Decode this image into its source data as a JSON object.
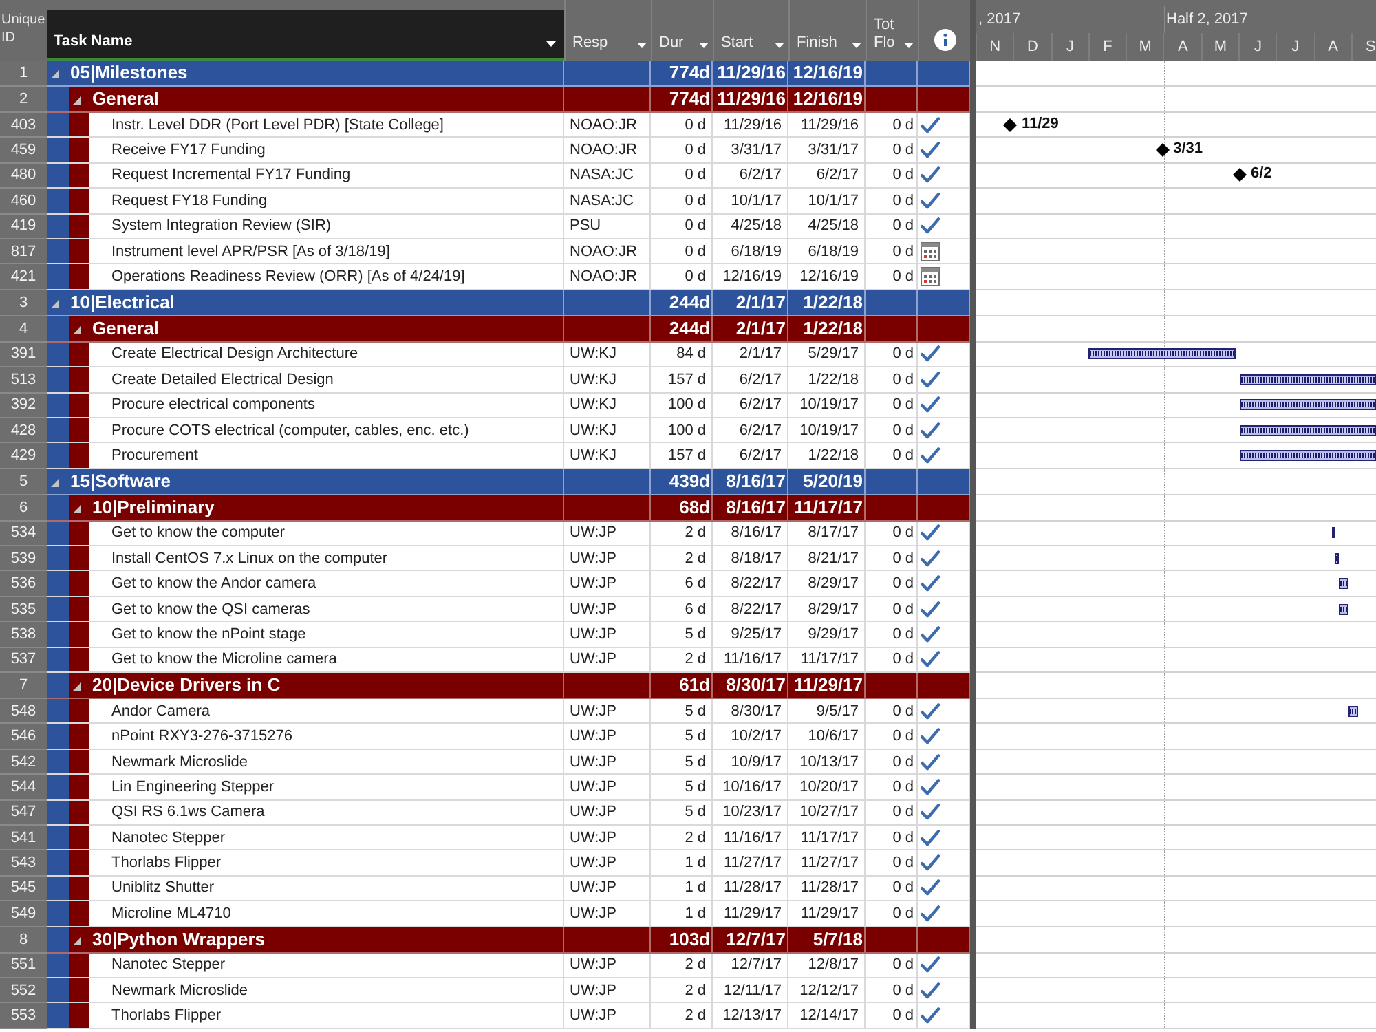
{
  "header": {
    "id_label": "Unique ID",
    "columns": [
      "Task Name",
      "Resp",
      "Dur",
      "Start",
      "Finish",
      "Tot Flo"
    ]
  },
  "timescale": {
    "periods": [
      ", 2017",
      "Half 2, 2017"
    ],
    "months": [
      "N",
      "D",
      "J",
      "F",
      "M",
      "A",
      "M",
      "J",
      "J",
      "A",
      "S"
    ]
  },
  "rows": [
    {
      "id": "1",
      "kind": "summary",
      "name": "05|Milestones",
      "expanded": true,
      "dur": "774d",
      "start": "11/29/16",
      "finish": "12/16/19",
      "children": [
        {
          "id": "2",
          "kind": "summary",
          "name": "General",
          "expanded": true,
          "dur": "774d",
          "start": "11/29/16",
          "finish": "12/16/19",
          "children": [
            {
              "id": "403",
              "kind": "milestone",
              "name": "Instr. Level DDR (Port Level PDR) [State College]",
              "resp": "NOAO:JR",
              "dur": "0 d",
              "start": "11/29/16",
              "finish": "11/29/16",
              "float": "0 d",
              "complete": true,
              "constrained": false,
              "bar_label": "11/29"
            },
            {
              "id": "459",
              "kind": "milestone",
              "name": "Receive FY17 Funding",
              "resp": "NOAO:JR",
              "dur": "0 d",
              "start": "3/31/17",
              "finish": "3/31/17",
              "float": "0 d",
              "complete": true,
              "constrained": false,
              "bar_label": "3/31"
            },
            {
              "id": "480",
              "kind": "milestone",
              "name": "Request Incremental FY17 Funding",
              "resp": "NASA:JC",
              "dur": "0 d",
              "start": "6/2/17",
              "finish": "6/2/17",
              "float": "0 d",
              "complete": true,
              "constrained": false,
              "bar_label": "6/2"
            },
            {
              "id": "460",
              "kind": "milestone",
              "name": "Request FY18 Funding",
              "resp": "NASA:JC",
              "dur": "0 d",
              "start": "10/1/17",
              "finish": "10/1/17",
              "float": "0 d",
              "complete": true,
              "constrained": false
            },
            {
              "id": "419",
              "kind": "milestone",
              "name": "System Integration Review (SIR)",
              "resp": "PSU",
              "dur": "0 d",
              "start": "4/25/18",
              "finish": "4/25/18",
              "float": "0 d",
              "complete": true,
              "constrained": false
            },
            {
              "id": "817",
              "kind": "milestone",
              "name": "Instrument level APR/PSR [As of 3/18/19]",
              "resp": "NOAO:JR",
              "dur": "0 d",
              "start": "6/18/19",
              "finish": "6/18/19",
              "float": "0 d",
              "complete": false,
              "constrained": true
            },
            {
              "id": "421",
              "kind": "milestone",
              "name": "Operations Readiness Review (ORR) [As of 4/24/19]",
              "resp": "NOAO:JR",
              "dur": "0 d",
              "start": "12/16/19",
              "finish": "12/16/19",
              "float": "0 d",
              "complete": false,
              "constrained": true
            }
          ]
        }
      ]
    },
    {
      "id": "3",
      "kind": "summary",
      "name": "10|Electrical",
      "expanded": true,
      "dur": "244d",
      "start": "2/1/17",
      "finish": "1/22/18",
      "children": [
        {
          "id": "4",
          "kind": "summary",
          "name": "General",
          "expanded": true,
          "dur": "244d",
          "start": "2/1/17",
          "finish": "1/22/18",
          "children": [
            {
              "id": "391",
              "kind": "task",
              "name": "Create Electrical Design Architecture",
              "resp": "UW:KJ",
              "dur": "84 d",
              "start": "2/1/17",
              "finish": "5/29/17",
              "float": "0 d",
              "complete": true,
              "constrained": false
            },
            {
              "id": "513",
              "kind": "task",
              "name": "Create Detailed Electrical Design",
              "resp": "UW:KJ",
              "dur": "157 d",
              "start": "6/2/17",
              "finish": "1/22/18",
              "float": "0 d",
              "complete": true,
              "constrained": false
            },
            {
              "id": "392",
              "kind": "task",
              "name": "Procure electrical components",
              "resp": "UW:KJ",
              "dur": "100 d",
              "start": "6/2/17",
              "finish": "10/19/17",
              "float": "0 d",
              "complete": true,
              "constrained": false
            },
            {
              "id": "428",
              "kind": "task",
              "name": "Procure COTS electrical (computer, cables, enc. etc.)",
              "resp": "UW:KJ",
              "dur": "100 d",
              "start": "6/2/17",
              "finish": "10/19/17",
              "float": "0 d",
              "complete": true,
              "constrained": false
            },
            {
              "id": "429",
              "kind": "task",
              "name": "Procurement",
              "resp": "UW:KJ",
              "dur": "157 d",
              "start": "6/2/17",
              "finish": "1/22/18",
              "float": "0 d",
              "complete": true,
              "constrained": false
            }
          ]
        }
      ]
    },
    {
      "id": "5",
      "kind": "summary",
      "name": "15|Software",
      "expanded": true,
      "dur": "439d",
      "start": "8/16/17",
      "finish": "5/20/19",
      "children": [
        {
          "id": "6",
          "kind": "summary",
          "name": "10|Preliminary",
          "expanded": true,
          "dur": "68d",
          "start": "8/16/17",
          "finish": "11/17/17",
          "children": [
            {
              "id": "534",
              "kind": "task",
              "name": "Get to know the computer",
              "resp": "UW:JP",
              "dur": "2 d",
              "start": "8/16/17",
              "finish": "8/17/17",
              "float": "0 d",
              "complete": true,
              "constrained": false
            },
            {
              "id": "539",
              "kind": "task",
              "name": "Install CentOS 7.x Linux on the computer",
              "resp": "UW:JP",
              "dur": "2 d",
              "start": "8/18/17",
              "finish": "8/21/17",
              "float": "0 d",
              "complete": true,
              "constrained": false
            },
            {
              "id": "536",
              "kind": "task",
              "name": "Get to know the Andor camera",
              "resp": "UW:JP",
              "dur": "6 d",
              "start": "8/22/17",
              "finish": "8/29/17",
              "float": "0 d",
              "complete": true,
              "constrained": false
            },
            {
              "id": "535",
              "kind": "task",
              "name": "Get to know the QSI cameras",
              "resp": "UW:JP",
              "dur": "6 d",
              "start": "8/22/17",
              "finish": "8/29/17",
              "float": "0 d",
              "complete": true,
              "constrained": false
            },
            {
              "id": "538",
              "kind": "task",
              "name": "Get to know the nPoint stage",
              "resp": "UW:JP",
              "dur": "5 d",
              "start": "9/25/17",
              "finish": "9/29/17",
              "float": "0 d",
              "complete": true,
              "constrained": false
            },
            {
              "id": "537",
              "kind": "task",
              "name": "Get to know the Microline camera",
              "resp": "UW:JP",
              "dur": "2 d",
              "start": "11/16/17",
              "finish": "11/17/17",
              "float": "0 d",
              "complete": true,
              "constrained": false
            }
          ]
        },
        {
          "id": "7",
          "kind": "summary",
          "name": "20|Device Drivers in C",
          "expanded": true,
          "dur": "61d",
          "start": "8/30/17",
          "finish": "11/29/17",
          "children": [
            {
              "id": "548",
              "kind": "task",
              "name": "Andor Camera",
              "resp": "UW:JP",
              "dur": "5 d",
              "start": "8/30/17",
              "finish": "9/5/17",
              "float": "0 d",
              "complete": true,
              "constrained": false
            },
            {
              "id": "546",
              "kind": "task",
              "name": "nPoint RXY3-276-3715276",
              "resp": "UW:JP",
              "dur": "5 d",
              "start": "10/2/17",
              "finish": "10/6/17",
              "float": "0 d",
              "complete": true,
              "constrained": false
            },
            {
              "id": "542",
              "kind": "task",
              "name": "Newmark Microslide",
              "resp": "UW:JP",
              "dur": "5 d",
              "start": "10/9/17",
              "finish": "10/13/17",
              "float": "0 d",
              "complete": true,
              "constrained": false
            },
            {
              "id": "544",
              "kind": "task",
              "name": "Lin Engineering Stepper",
              "resp": "UW:JP",
              "dur": "5 d",
              "start": "10/16/17",
              "finish": "10/20/17",
              "float": "0 d",
              "complete": true,
              "constrained": false
            },
            {
              "id": "547",
              "kind": "task",
              "name": "QSI RS 6.1ws Camera",
              "resp": "UW:JP",
              "dur": "5 d",
              "start": "10/23/17",
              "finish": "10/27/17",
              "float": "0 d",
              "complete": true,
              "constrained": false
            },
            {
              "id": "541",
              "kind": "task",
              "name": "Nanotec Stepper",
              "resp": "UW:JP",
              "dur": "2 d",
              "start": "11/16/17",
              "finish": "11/17/17",
              "float": "0 d",
              "complete": true,
              "constrained": false
            },
            {
              "id": "543",
              "kind": "task",
              "name": "Thorlabs Flipper",
              "resp": "UW:JP",
              "dur": "1 d",
              "start": "11/27/17",
              "finish": "11/27/17",
              "float": "0 d",
              "complete": true,
              "constrained": false
            },
            {
              "id": "545",
              "kind": "task",
              "name": "Uniblitz Shutter",
              "resp": "UW:JP",
              "dur": "1 d",
              "start": "11/28/17",
              "finish": "11/28/17",
              "float": "0 d",
              "complete": true,
              "constrained": false
            },
            {
              "id": "549",
              "kind": "task",
              "name": "Microline ML4710",
              "resp": "UW:JP",
              "dur": "1 d",
              "start": "11/29/17",
              "finish": "11/29/17",
              "float": "0 d",
              "complete": true,
              "constrained": false
            }
          ]
        },
        {
          "id": "8",
          "kind": "summary",
          "name": "30|Python Wrappers",
          "expanded": true,
          "dur": "103d",
          "start": "12/7/17",
          "finish": "5/7/18",
          "children": [
            {
              "id": "551",
              "kind": "task",
              "name": "Nanotec Stepper",
              "resp": "UW:JP",
              "dur": "2 d",
              "start": "12/7/17",
              "finish": "12/8/17",
              "float": "0 d",
              "complete": true,
              "constrained": false
            },
            {
              "id": "552",
              "kind": "task",
              "name": "Newmark Microslide",
              "resp": "UW:JP",
              "dur": "2 d",
              "start": "12/11/17",
              "finish": "12/12/17",
              "float": "0 d",
              "complete": true,
              "constrained": false
            },
            {
              "id": "553",
              "kind": "task",
              "name": "Thorlabs Flipper",
              "resp": "UW:JP",
              "dur": "2 d",
              "start": "12/13/17",
              "finish": "12/14/17",
              "float": "0 d",
              "complete": true,
              "constrained": false
            }
          ]
        }
      ]
    }
  ]
}
